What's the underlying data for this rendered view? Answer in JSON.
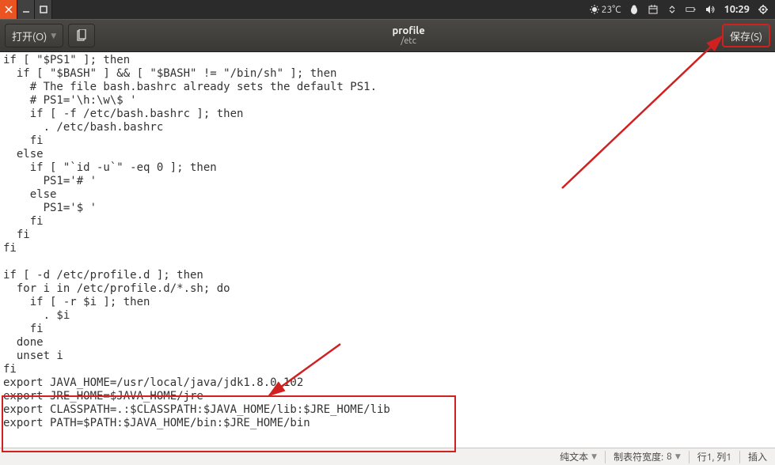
{
  "panel": {
    "temperature": "23°C",
    "clock": "10:29"
  },
  "toolbar": {
    "open_label": "打开(O)",
    "save_label": "保存(S)",
    "title": "profile",
    "path": "/etc"
  },
  "editor": {
    "content": "if [ \"$PS1\" ]; then\n  if [ \"$BASH\" ] && [ \"$BASH\" != \"/bin/sh\" ]; then\n    # The file bash.bashrc already sets the default PS1.\n    # PS1='\\h:\\w\\$ '\n    if [ -f /etc/bash.bashrc ]; then\n      . /etc/bash.bashrc\n    fi\n  else\n    if [ \"`id -u`\" -eq 0 ]; then\n      PS1='# '\n    else\n      PS1='$ '\n    fi\n  fi\nfi\n\nif [ -d /etc/profile.d ]; then\n  for i in /etc/profile.d/*.sh; do\n    if [ -r $i ]; then\n      . $i\n    fi\n  done\n  unset i\nfi\nexport JAVA_HOME=/usr/local/java/jdk1.8.0_102\nexport JRE_HOME=$JAVA_HOME/jre\nexport CLASSPATH=.:$CLASSPATH:$JAVA_HOME/lib:$JRE_HOME/lib\nexport PATH=$PATH:$JAVA_HOME/bin:$JRE_HOME/bin"
  },
  "statusbar": {
    "syntax": "纯文本",
    "tab_width_label": "制表符宽度:",
    "tab_width_value": "8",
    "cursor": "行1, 列1",
    "mode": "插入"
  },
  "colors": {
    "accent_orange": "#e95420",
    "annotation_red": "#d02020",
    "panel_bg": "#2b2b2b",
    "toolbar_bg": "#3e3c39"
  }
}
